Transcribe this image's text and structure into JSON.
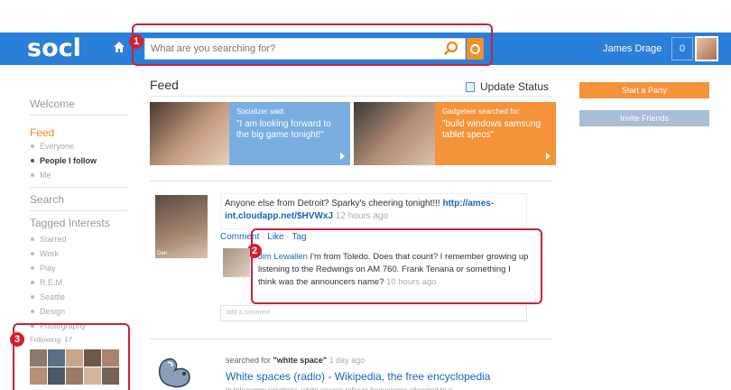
{
  "header": {
    "logo": "socl",
    "search_placeholder": "What are you searching for?",
    "user_name": "James Drage",
    "notification_count": "0"
  },
  "callouts": [
    "1",
    "2",
    "3"
  ],
  "sidebar": {
    "welcome": "Welcome",
    "feed": "Feed",
    "feed_items": [
      {
        "label": "Everyone",
        "active": false
      },
      {
        "label": "People I follow",
        "active": true
      },
      {
        "label": "Me",
        "active": false
      }
    ],
    "search": "Search",
    "tagged_interests": "Tagged Interests",
    "interests": [
      "Starred",
      "Work",
      "Play",
      "R.E.M.",
      "Seattle",
      "Design",
      "Photography"
    ],
    "following": "Following: 17"
  },
  "feed": {
    "title": "Feed",
    "update_status": "Update Status",
    "tiles": [
      {
        "head": "Socializer said:",
        "body": "\"I am looking forward to the big game tonight!\"",
        "color": "#7aaee0"
      },
      {
        "head": "Gadgeteer searched for:",
        "body": "\"build windows samsung tablet specs\"",
        "color": "#f5933a"
      }
    ],
    "post": {
      "avatar_name": "Dan",
      "text": "Anyone else from Detroit? Sparky's cheering tonight!!! ",
      "link": "http://ames-int.cloudapp.net/$HVWxJ",
      "time": " 12 hours ago",
      "actions": [
        "Comment",
        "Like",
        "Tag"
      ],
      "comment": {
        "author": "Jim Lewallen",
        "text": " I'm from Toledo. Does that count? I remember growing up listening to the Redwings on AM 760. Frank Tenana or something I think was the announcers name?",
        "time": " 10 hours ago"
      },
      "add_comment_placeholder": "add a comment"
    },
    "search_item": {
      "prefix": "searched for ",
      "query": "\"white space\"",
      "time": " 1 day ago",
      "result_title": "White spaces (radio) - Wikipedia, the free encyclopedia",
      "snippet": "In telecommunications, white spaces refer to frequencies allocated to a"
    }
  },
  "right": {
    "start_party": "Start a Party",
    "invite_friends": "Invite Friends"
  },
  "colors": {
    "topbar": "#2a7fd8",
    "accent_orange": "#f5933a",
    "link_blue": "#1c64b8",
    "callout_red": "#c8233a"
  }
}
